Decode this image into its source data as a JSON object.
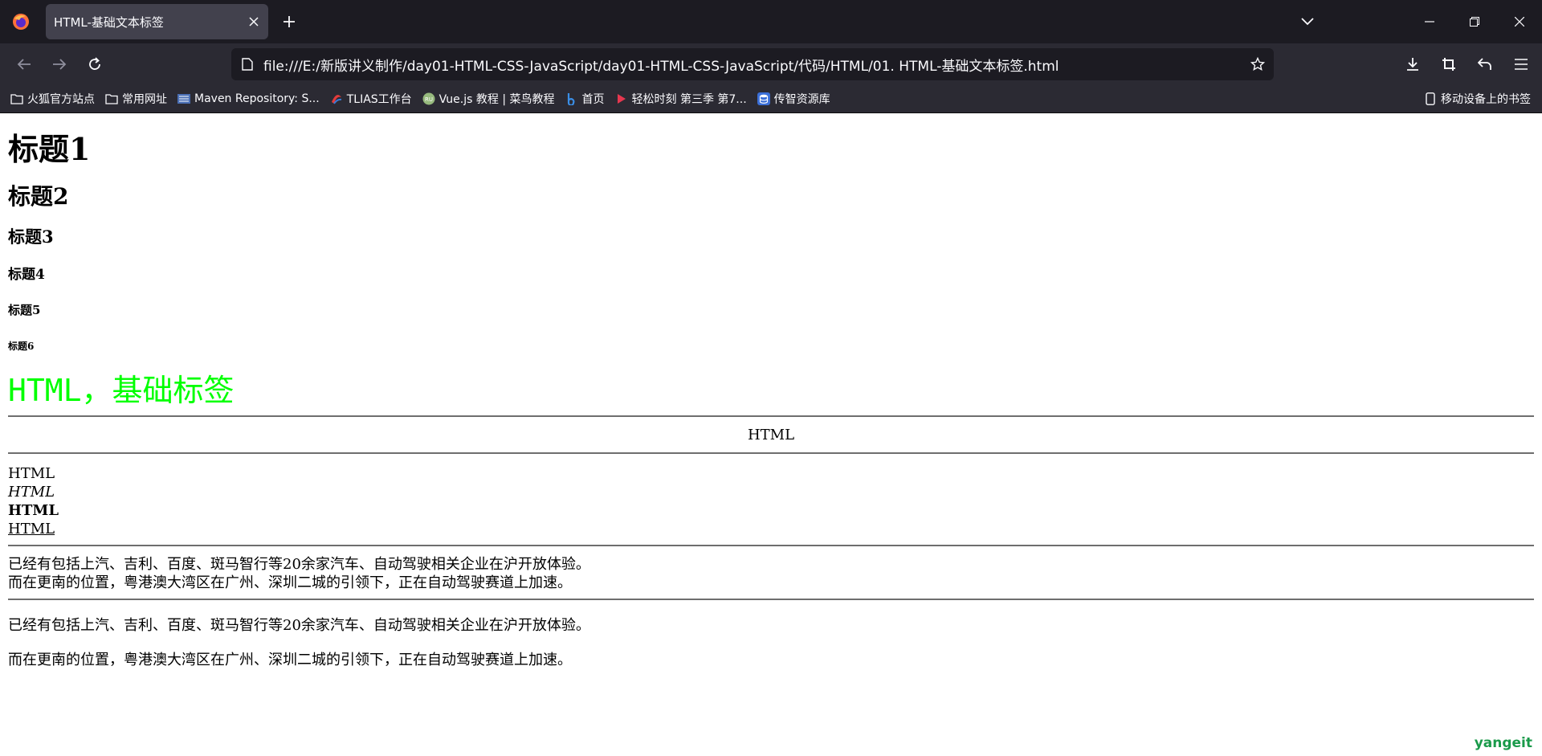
{
  "browser": {
    "tab_title": "HTML-基础文本标签",
    "url": "file:///E:/新版讲义制作/day01-HTML-CSS-JavaScript/day01-HTML-CSS-JavaScript/代码/HTML/01. HTML-基础文本标签.html",
    "bookmarks": [
      {
        "label": "火狐官方站点",
        "icon": "folder-icon"
      },
      {
        "label": "常用网址",
        "icon": "folder-icon"
      },
      {
        "label": "Maven Repository: S...",
        "icon": "maven-icon"
      },
      {
        "label": "TLIAS工作台",
        "icon": "tlias-icon"
      },
      {
        "label": "Vue.js 教程 | 菜鸟教程",
        "icon": "runoob-icon"
      },
      {
        "label": "首页",
        "icon": "bilibili-icon"
      },
      {
        "label": "轻松时刻 第三季 第7...",
        "icon": "video-icon"
      },
      {
        "label": "传智资源库",
        "icon": "database-icon"
      }
    ],
    "mobile_bookmarks": "移动设备上的书签"
  },
  "page": {
    "h1": "标题1",
    "h2": "标题2",
    "h3": "标题3",
    "h4": "标题4",
    "h5": "标题5",
    "h6": "标题6",
    "font_text": "HTML，基础标签",
    "font_color": "#00ff00",
    "centered": "HTML",
    "plain": "HTML",
    "italic": "HTML",
    "bold": "HTML",
    "underline": "HTML",
    "line1": "已经有包括上汽、吉利、百度、斑马智行等20余家汽车、自动驾驶相关企业在沪开放体验。",
    "line2": "而在更南的位置，粤港澳大湾区在广州、深圳二城的引领下，正在自动驾驶赛道上加速。",
    "p1": "已经有包括上汽、吉利、百度、斑马智行等20余家汽车、自动驾驶相关企业在沪开放体验。",
    "p2": "而在更南的位置，粤港澳大湾区在广州、深圳二城的引领下，正在自动驾驶赛道上加速。"
  },
  "watermark": "yangeit"
}
